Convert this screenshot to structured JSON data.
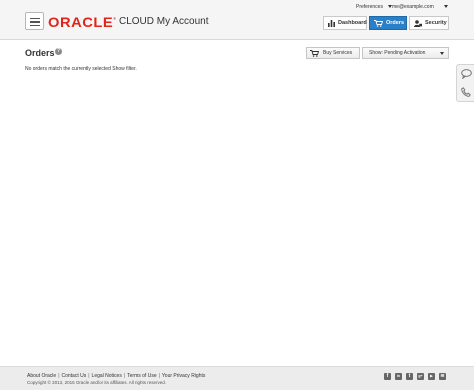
{
  "header": {
    "brand": "ORACLE",
    "brand_mark": "®",
    "product": "CLOUD My Account",
    "preferences_label": "Preferences",
    "user_email": "me@example.com",
    "nav": [
      {
        "label": "Dashboard",
        "icon": "dashboard-icon",
        "active": false
      },
      {
        "label": "Orders",
        "icon": "cart-icon",
        "active": true
      },
      {
        "label": "Security",
        "icon": "security-icon",
        "active": false
      }
    ],
    "accent_color": "#2a7fc6",
    "brand_color": "#e2231a"
  },
  "main": {
    "title": "Orders",
    "help_glyph": "?",
    "buy_services_label": "Buy Services",
    "show_filter_label": "Show: Pending Activation",
    "empty_message": "No orders match the currently selected Show filter."
  },
  "side_panel": {
    "icons": [
      "chat-icon",
      "phone-icon"
    ]
  },
  "footer": {
    "links": [
      "About Oracle",
      "Contact Us",
      "Legal Notices",
      "Terms of Use",
      "Your Privacy Rights"
    ],
    "copyright": "Copyright © 2013, 2015 Oracle and/or its affiliates. All rights reserved.",
    "social": [
      {
        "icon": "facebook-icon",
        "glyph": "f"
      },
      {
        "icon": "linkedin-icon",
        "glyph": "in"
      },
      {
        "icon": "twitter-icon",
        "glyph": "t"
      },
      {
        "icon": "google-plus-icon",
        "glyph": "g+"
      },
      {
        "icon": "youtube-icon",
        "glyph": "▶"
      },
      {
        "icon": "rss-icon",
        "glyph": "≋"
      }
    ]
  }
}
